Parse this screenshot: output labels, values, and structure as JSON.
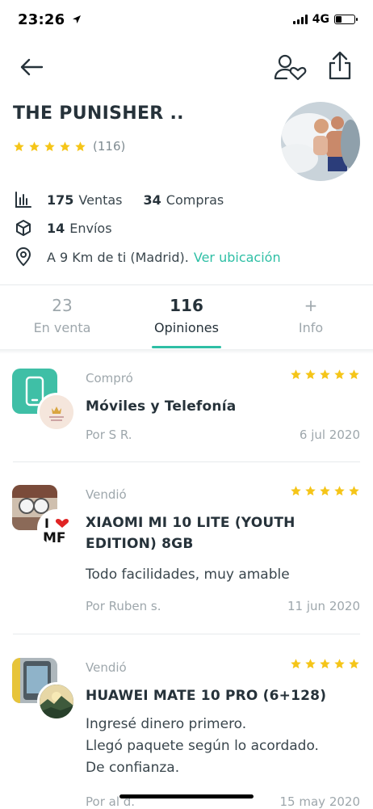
{
  "status": {
    "time": "23:26",
    "network": "4G"
  },
  "profile": {
    "name": "THE PUNISHER ..",
    "rating_count": "(116)",
    "sales_count": "175",
    "sales_label": "Ventas",
    "purchases_count": "34",
    "purchases_label": "Compras",
    "shipments_count": "14",
    "shipments_label": "Envíos",
    "location_text": "A 9 Km de ti (Madrid).",
    "location_link": "Ver ubicación"
  },
  "tabs": [
    {
      "value": "23",
      "label": "En venta"
    },
    {
      "value": "116",
      "label": "Opiniones"
    },
    {
      "value": "+",
      "label": "Info"
    }
  ],
  "reviews": [
    {
      "kind": "Compró",
      "title": "Móviles y Telefonía",
      "text": "",
      "by": "Por S R.",
      "date": "6 jul 2020",
      "rating": 5
    },
    {
      "kind": "Vendió",
      "title": "XIAOMI MI 10 LITE (YOUTH EDITION) 8GB",
      "text": "Todo facilidades, muy amable",
      "by": "Por Ruben s.",
      "date": "11 jun 2020",
      "rating": 5
    },
    {
      "kind": "Vendió",
      "title": "HUAWEI MATE 10 PRO (6+128)",
      "text": "Ingresé dinero primero.\nLlegó paquete según lo acordado.\nDe confianza.",
      "by": "Por al d.",
      "date": "15 may 2020",
      "rating": 5
    }
  ],
  "colors": {
    "accent": "#2ebfa5",
    "star": "#f5c518",
    "text": "#26323a",
    "muted": "#9ea7ac"
  },
  "icons": [
    "back-arrow-icon",
    "follow-user-heart-icon",
    "share-icon",
    "bar-chart-icon",
    "box-icon",
    "location-pin-icon",
    "star-icon",
    "phone-icon"
  ]
}
